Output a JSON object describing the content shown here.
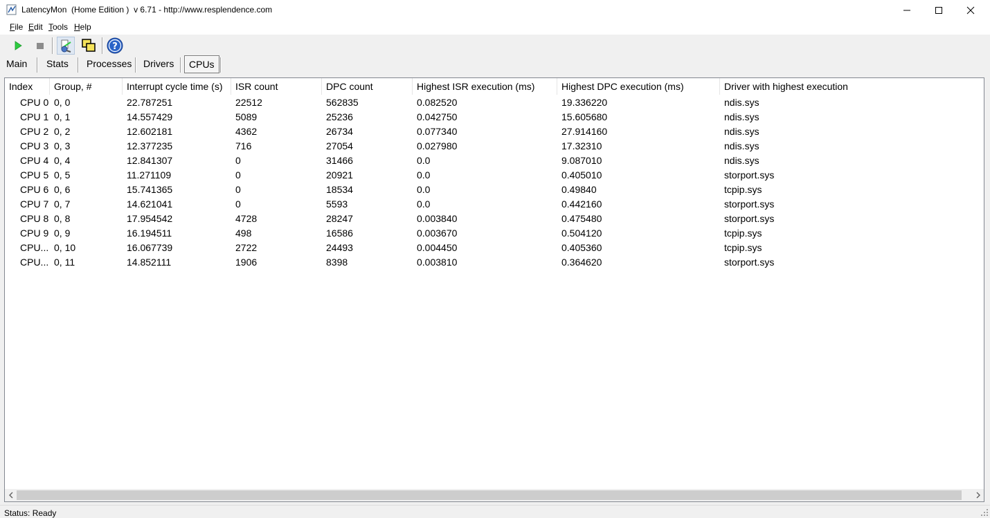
{
  "window": {
    "title": "LatencyMon  (Home Edition )  v 6.71 - http://www.resplendence.com"
  },
  "menu": [
    {
      "accel": "F",
      "rest": "ile"
    },
    {
      "accel": "E",
      "rest": "dit"
    },
    {
      "accel": "T",
      "rest": "ools"
    },
    {
      "accel": "H",
      "rest": "elp"
    }
  ],
  "toolbar": {
    "icons": [
      "play-icon",
      "stop-icon",
      "drivers-search-icon",
      "windows-icon",
      "help-icon"
    ]
  },
  "tabs": [
    {
      "label": "Main"
    },
    {
      "label": "Stats"
    },
    {
      "label": "Processes"
    },
    {
      "label": "Drivers"
    },
    {
      "label": "CPUs"
    }
  ],
  "table": {
    "headers": [
      "Index",
      "Group, #",
      "Interrupt cycle time (s)",
      "ISR count",
      "DPC count",
      "Highest ISR execution (ms)",
      "Highest DPC execution (ms)",
      "Driver with highest execution"
    ],
    "rows": [
      [
        "CPU 0",
        "0, 0",
        "22.787251",
        "22512",
        "562835",
        "0.082520",
        "19.336220",
        "ndis.sys"
      ],
      [
        "CPU 1",
        "0, 1",
        "14.557429",
        "5089",
        "25236",
        "0.042750",
        "15.605680",
        "ndis.sys"
      ],
      [
        "CPU 2",
        "0, 2",
        "12.602181",
        "4362",
        "26734",
        "0.077340",
        "27.914160",
        "ndis.sys"
      ],
      [
        "CPU 3",
        "0, 3",
        "12.377235",
        "716",
        "27054",
        "0.027980",
        "17.32310",
        "ndis.sys"
      ],
      [
        "CPU 4",
        "0, 4",
        "12.841307",
        "0",
        "31466",
        "0.0",
        "9.087010",
        "ndis.sys"
      ],
      [
        "CPU 5",
        "0, 5",
        "11.271109",
        "0",
        "20921",
        "0.0",
        "0.405010",
        "storport.sys"
      ],
      [
        "CPU 6",
        "0, 6",
        "15.741365",
        "0",
        "18534",
        "0.0",
        "0.49840",
        "tcpip.sys"
      ],
      [
        "CPU 7",
        "0, 7",
        "14.621041",
        "0",
        "5593",
        "0.0",
        "0.442160",
        "storport.sys"
      ],
      [
        "CPU 8",
        "0, 8",
        "17.954542",
        "4728",
        "28247",
        "0.003840",
        "0.475480",
        "storport.sys"
      ],
      [
        "CPU 9",
        "0, 9",
        "16.194511",
        "498",
        "16586",
        "0.003670",
        "0.504120",
        "tcpip.sys"
      ],
      [
        "CPU...",
        "0, 10",
        "16.067739",
        "2722",
        "24493",
        "0.004450",
        "0.405360",
        "tcpip.sys"
      ],
      [
        "CPU...",
        "0, 11",
        "14.852111",
        "1906",
        "8398",
        "0.003810",
        "0.364620",
        "storport.sys"
      ]
    ]
  },
  "status": {
    "text": "Status: Ready"
  }
}
